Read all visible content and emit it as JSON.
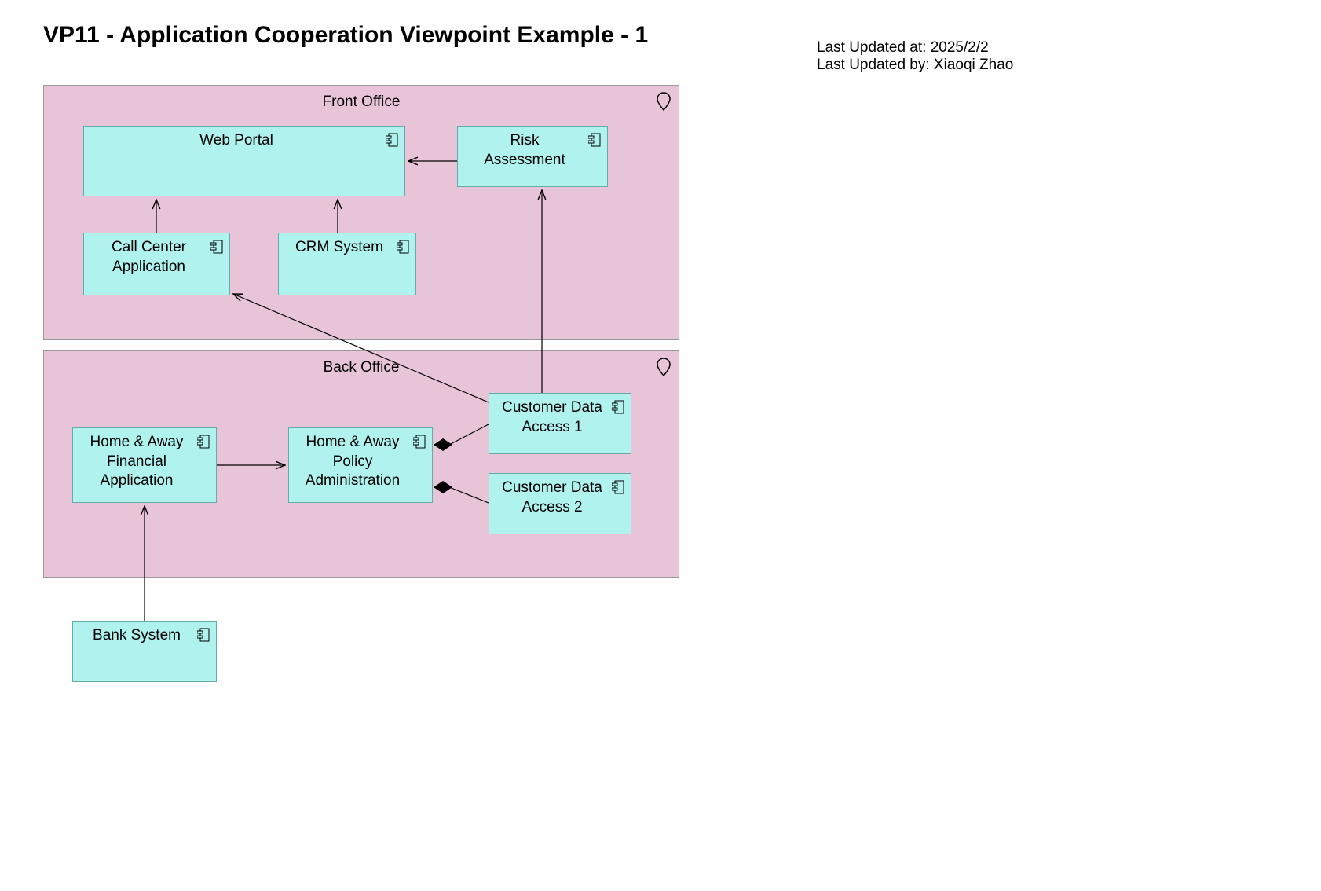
{
  "title": "VP11 - Application Cooperation Viewpoint Example - 1",
  "meta": {
    "updated_at_label": "Last Updated at: 2025/2/2",
    "updated_by_label": "Last Updated by: Xiaoqi Zhao"
  },
  "groups": {
    "front_office": {
      "label": "Front Office"
    },
    "back_office": {
      "label": "Back Office"
    }
  },
  "nodes": {
    "web_portal": {
      "label": "Web Portal"
    },
    "risk_assessment": {
      "label": "Risk\nAssessment"
    },
    "call_center": {
      "label": "Call Center\nApplication"
    },
    "crm_system": {
      "label": "CRM System"
    },
    "ha_financial": {
      "label": "Home & Away\nFinancial\nApplication"
    },
    "ha_policy": {
      "label": "Home & Away\nPolicy\nAdministration"
    },
    "cust_data_1": {
      "label": "Customer Data\nAccess 1"
    },
    "cust_data_2": {
      "label": "Customer Data\nAccess 2"
    },
    "bank_system": {
      "label": "Bank System"
    }
  },
  "edges": [
    {
      "from": "risk_assessment",
      "to": "web_portal",
      "type": "arrow"
    },
    {
      "from": "call_center",
      "to": "web_portal",
      "type": "arrow"
    },
    {
      "from": "crm_system",
      "to": "web_portal",
      "type": "arrow"
    },
    {
      "from": "cust_data_1",
      "to": "call_center",
      "type": "arrow"
    },
    {
      "from": "cust_data_1",
      "to": "risk_assessment",
      "type": "arrow"
    },
    {
      "from": "ha_financial",
      "to": "ha_policy",
      "type": "arrow"
    },
    {
      "from": "bank_system",
      "to": "ha_financial",
      "type": "arrow"
    },
    {
      "from": "ha_policy",
      "to": "cust_data_1",
      "type": "composition"
    },
    {
      "from": "ha_policy",
      "to": "cust_data_2",
      "type": "composition"
    }
  ]
}
